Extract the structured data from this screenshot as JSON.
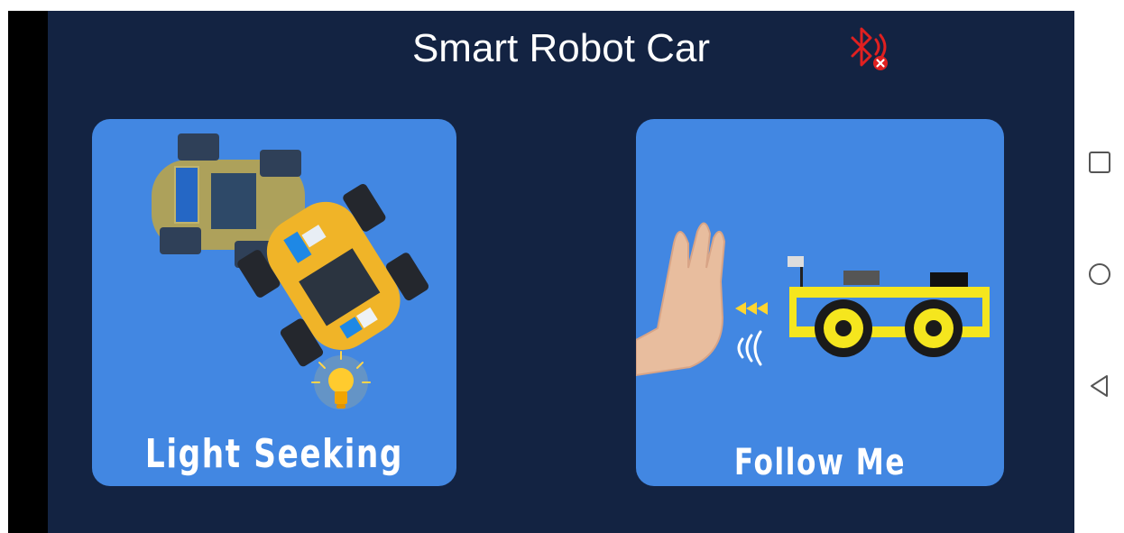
{
  "app": {
    "title": "Smart Robot Car",
    "bluetooth_status_icon": "bluetooth-disconnected-icon"
  },
  "cards": [
    {
      "label": "Light Seeking",
      "illustration": "robot-car-top-view-with-lightbulb"
    },
    {
      "label": "Follow Me",
      "illustration": "hand-and-robot-car-side-view"
    }
  ],
  "navbar": {
    "icons": [
      "recent-apps-icon",
      "home-icon",
      "back-icon"
    ]
  },
  "colors": {
    "app_background": "#132342",
    "card_background": "#4287e2",
    "bluetooth_icon": "#e02020"
  }
}
